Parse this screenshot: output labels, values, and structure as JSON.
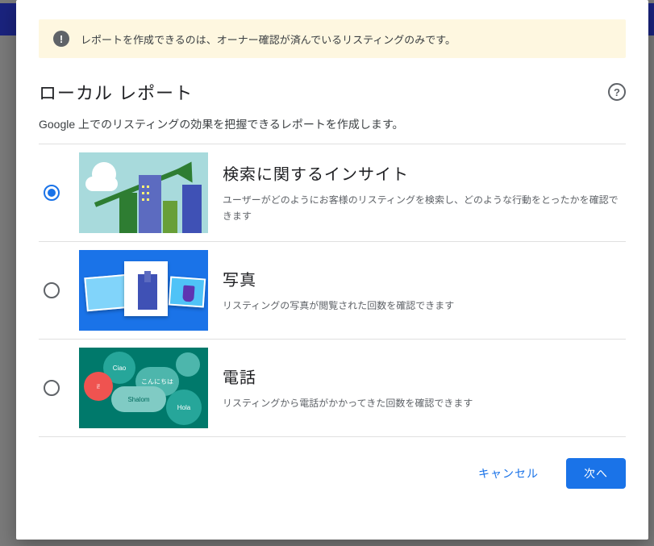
{
  "alert": {
    "text": "レポートを作成できるのは、オーナー確認が済んでいるリスティングのみです。"
  },
  "header": {
    "title": "ローカル レポート",
    "subtitle": "Google 上でのリスティングの効果を把握できるレポートを作成します。"
  },
  "options": [
    {
      "title": "検索に関するインサイト",
      "desc": "ユーザーがどのようにお客様のリスティングを検索し、どのような行動をとったかを確認できます",
      "selected": true
    },
    {
      "title": "写真",
      "desc": "リスティングの写真が閲覧された回数を確認できます",
      "selected": false
    },
    {
      "title": "電話",
      "desc": "リスティングから電話がかかってきた回数を確認できます",
      "selected": false
    }
  ],
  "footer": {
    "cancel": "キャンセル",
    "next": "次へ"
  },
  "bubbles": {
    "b1": "Ciao",
    "b2": "こんにちは",
    "b3": "i!",
    "b4": "Shalom",
    "b5": "Hola",
    "b6": ""
  }
}
